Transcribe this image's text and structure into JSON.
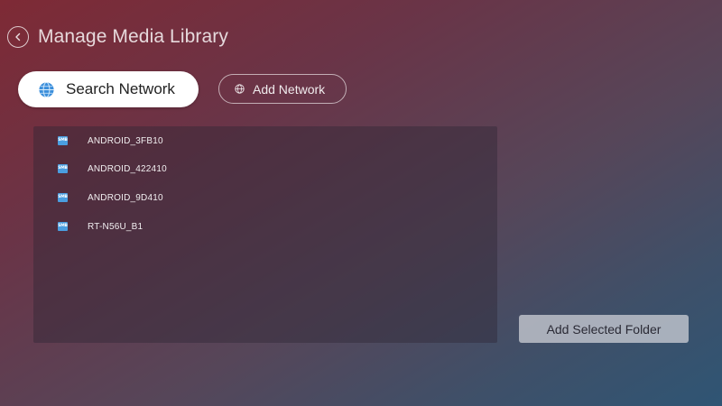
{
  "header": {
    "title": "Manage Media Library",
    "back_icon": "chevron-left-icon"
  },
  "tabs": {
    "search_network": {
      "label": "Search Network",
      "icon": "globe-icon",
      "selected": true
    },
    "add_network": {
      "label": "Add Network",
      "icon": "globe-icon"
    }
  },
  "network_list": {
    "items": [
      {
        "label": "ANDROID_3FB10",
        "icon": "smb-icon"
      },
      {
        "label": "ANDROID_422410",
        "icon": "smb-icon"
      },
      {
        "label": "ANDROID_9D410",
        "icon": "smb-icon"
      },
      {
        "label": "RT-N56U_B1",
        "icon": "smb-icon"
      }
    ]
  },
  "actions": {
    "add_selected_folder_label": "Add Selected Folder"
  },
  "colors": {
    "background_start": "#7e2a35",
    "background_end": "#2f5574",
    "selected_tab_bg": "#ffffff",
    "smb_icon": "#4a9ee0"
  }
}
